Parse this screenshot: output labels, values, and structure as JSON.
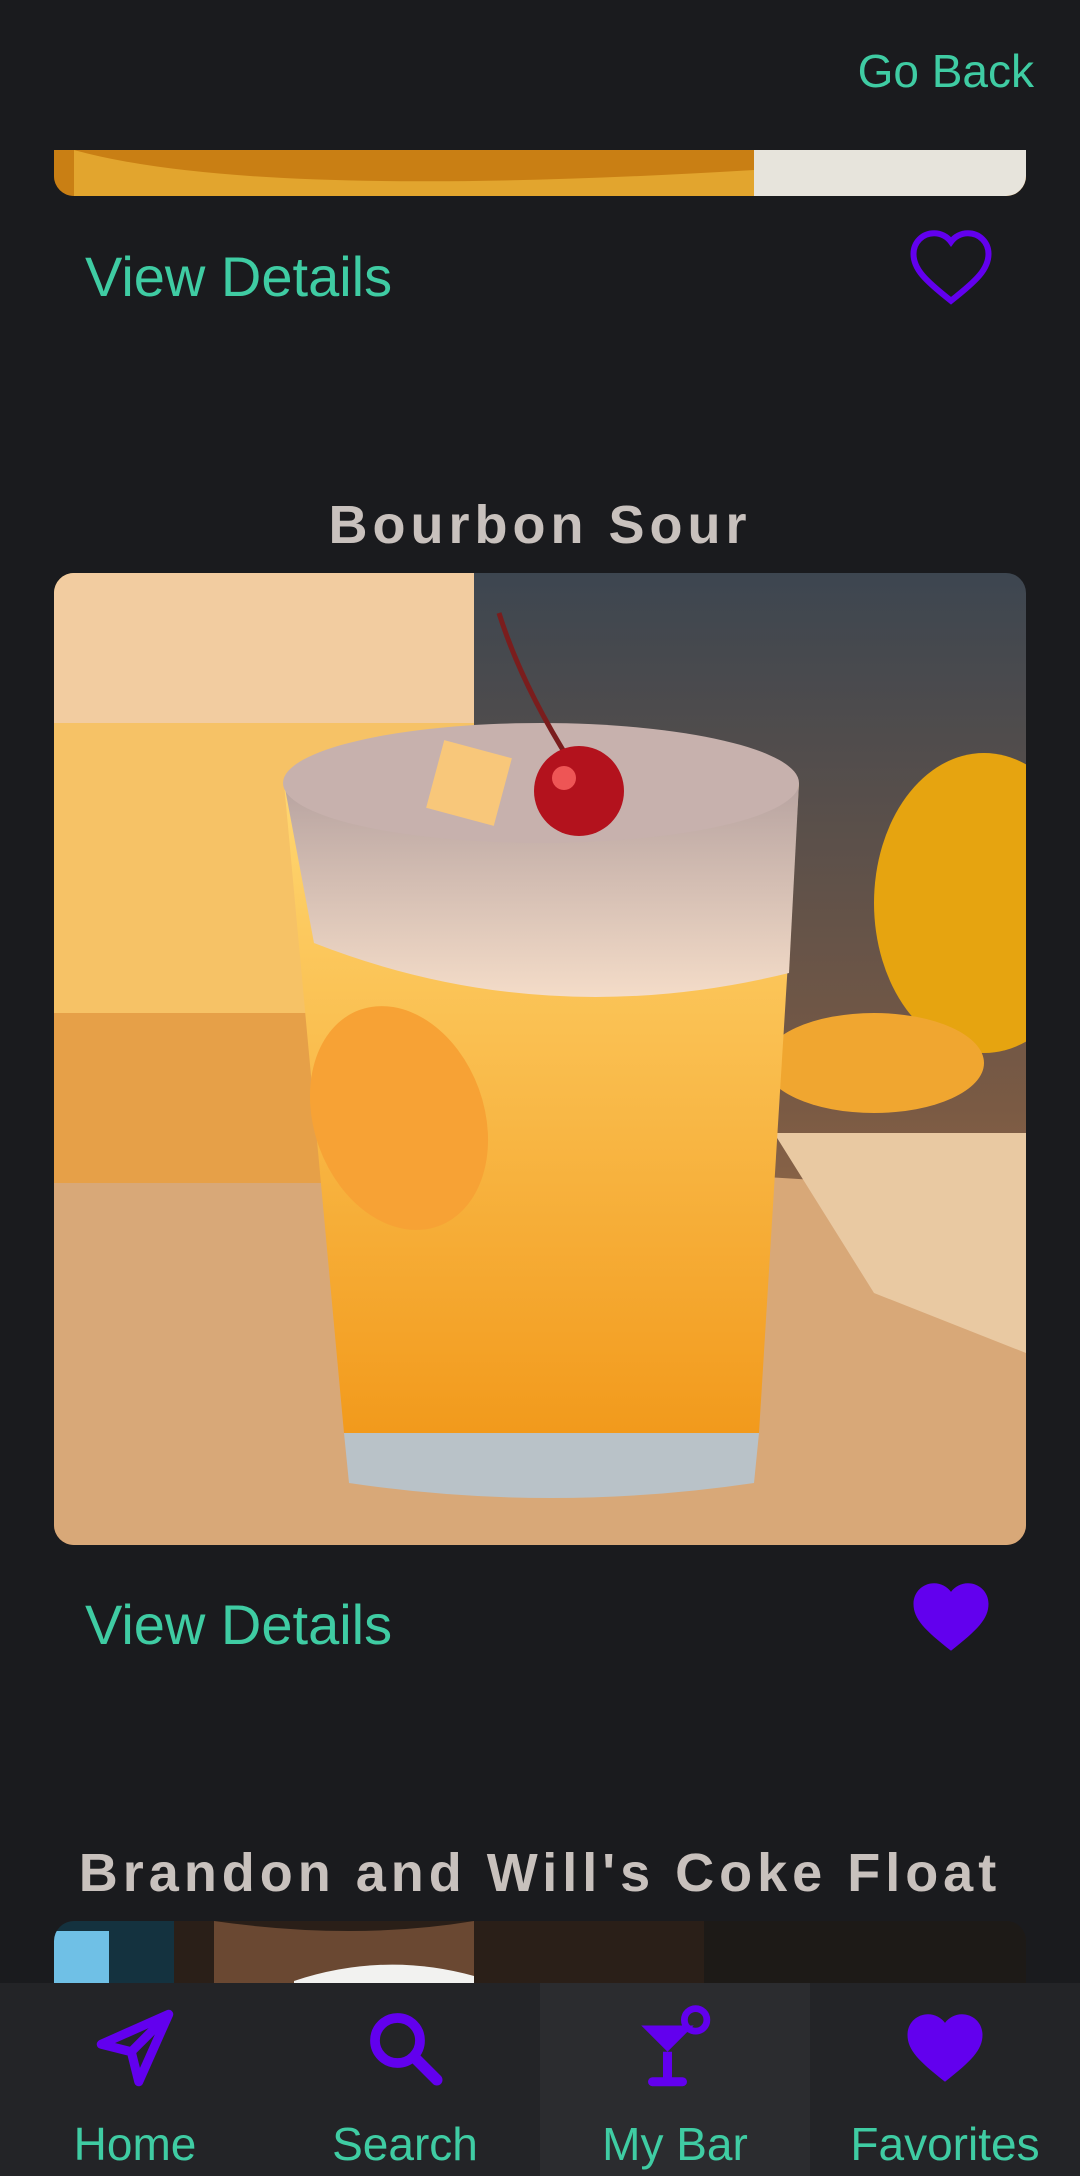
{
  "header": {
    "go_back_label": "Go Back"
  },
  "cards": [
    {
      "title": "",
      "view_details_label": "View Details",
      "favorited": false
    },
    {
      "title": "Bourbon Sour",
      "view_details_label": "View Details",
      "favorited": true
    },
    {
      "title": "Brandon and Will's Coke Float"
    }
  ],
  "nav": {
    "items": [
      {
        "label": "Home",
        "icon": "paper-plane-icon"
      },
      {
        "label": "Search",
        "icon": "search-icon"
      },
      {
        "label": "My Bar",
        "icon": "cocktail-icon",
        "selected": true
      },
      {
        "label": "Favorites",
        "icon": "heart-icon"
      }
    ]
  },
  "colors": {
    "accent": "#3fcca3",
    "heart": "#6200ee",
    "background": "#1a1b1e"
  }
}
